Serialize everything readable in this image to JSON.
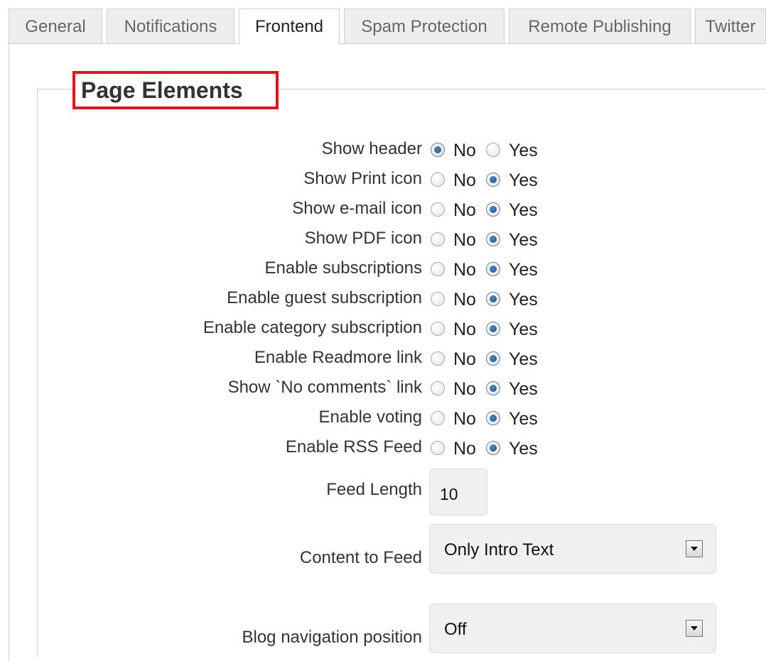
{
  "tabs": [
    {
      "label": "General",
      "active": false
    },
    {
      "label": "Notifications",
      "active": false
    },
    {
      "label": "Frontend",
      "active": true
    },
    {
      "label": "Spam Protection",
      "active": false
    },
    {
      "label": "Remote Publishing",
      "active": false
    },
    {
      "label": "Twitter",
      "active": false
    }
  ],
  "section": {
    "legend": "Page Elements",
    "highlight_color": "#e0141b"
  },
  "options": {
    "no": "No",
    "yes": "Yes"
  },
  "rows": [
    {
      "label": "Show header",
      "selected": "No"
    },
    {
      "label": "Show Print icon",
      "selected": "Yes"
    },
    {
      "label": "Show e-mail icon",
      "selected": "Yes"
    },
    {
      "label": "Show PDF icon",
      "selected": "Yes"
    },
    {
      "label": "Enable subscriptions",
      "selected": "Yes"
    },
    {
      "label": "Enable guest subscription",
      "selected": "Yes"
    },
    {
      "label": "Enable category subscription",
      "selected": "Yes"
    },
    {
      "label": "Enable Readmore link",
      "selected": "Yes"
    },
    {
      "label": "Show `No comments` link",
      "selected": "Yes"
    },
    {
      "label": "Enable voting",
      "selected": "Yes"
    },
    {
      "label": "Enable RSS Feed",
      "selected": "Yes"
    }
  ],
  "feed_length": {
    "label": "Feed Length",
    "value": "10"
  },
  "content_to_feed": {
    "label": "Content to Feed",
    "value": "Only Intro Text"
  },
  "blog_navigation": {
    "label": "Blog navigation position",
    "value": "Off"
  }
}
